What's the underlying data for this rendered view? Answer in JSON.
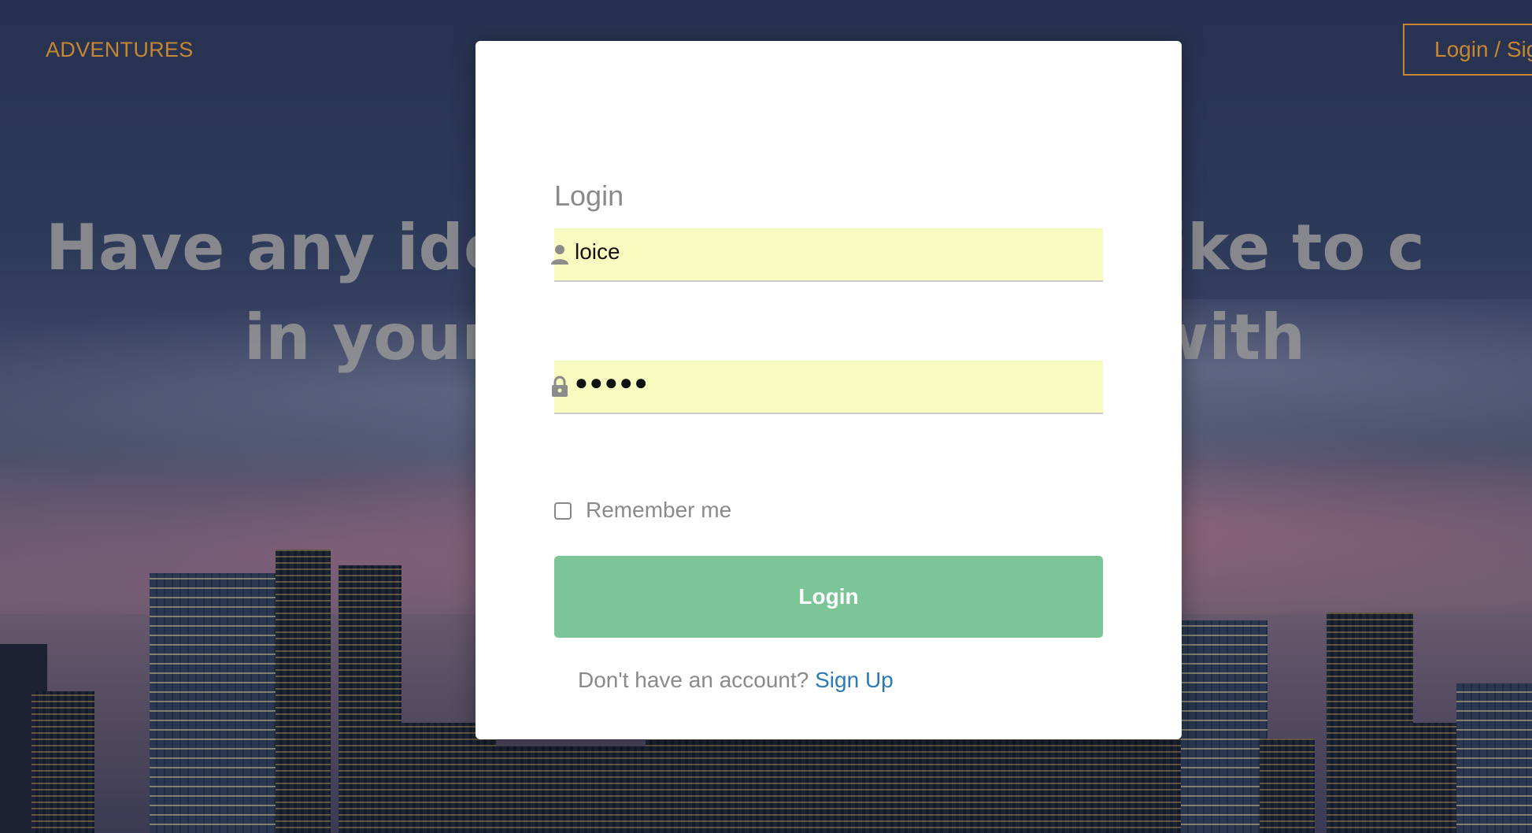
{
  "nav": {
    "brand": "ADVENTURES",
    "login_signup": "Login / Sig"
  },
  "hero": {
    "line1": "Have any ide                       uld like to c",
    "line2": "in your                         ed with"
  },
  "login_modal": {
    "title": "Login",
    "username_value": "loice",
    "password_masked": "●●●●●",
    "remember_label": "Remember me",
    "remember_checked": false,
    "login_button": "Login",
    "no_account_text": "Don't have an account?",
    "signup_link": "Sign Up"
  },
  "icons": {
    "user": "user-icon",
    "lock": "lock-icon"
  },
  "colors": {
    "brand": "#c7862f",
    "field_bg": "#f8fbbf",
    "login_button": "#7cc598",
    "link": "#2a7ab8"
  }
}
